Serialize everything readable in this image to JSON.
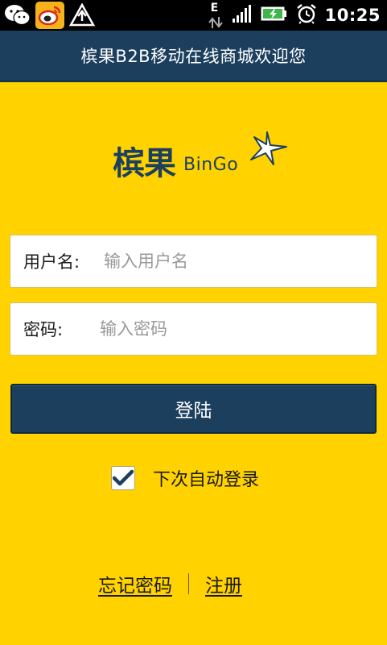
{
  "status_bar": {
    "time": "10:25",
    "network_label": "E",
    "icons": [
      "wechat-icon",
      "weibo-icon",
      "airdroid-icon",
      "data-arrows-icon",
      "signal-icon",
      "battery-charging-icon",
      "alarm-clock-icon"
    ]
  },
  "header": {
    "title": "槟果B2B移动在线商城欢迎您"
  },
  "logo": {
    "cn_text": "槟果",
    "en_text": "BinGo"
  },
  "form": {
    "username_label": "用户名:",
    "username_placeholder": "输入用户名",
    "username_value": "",
    "password_label": "密码:",
    "password_placeholder": "输入密码",
    "password_value": ""
  },
  "login_button": {
    "label": "登陆"
  },
  "auto_login": {
    "label": "下次自动登录",
    "checked": true
  },
  "links": {
    "forgot_password": "忘记密码",
    "register": "注册"
  },
  "colors": {
    "background": "#ffd200",
    "primary": "#1c3f5e",
    "placeholder": "#999999"
  }
}
